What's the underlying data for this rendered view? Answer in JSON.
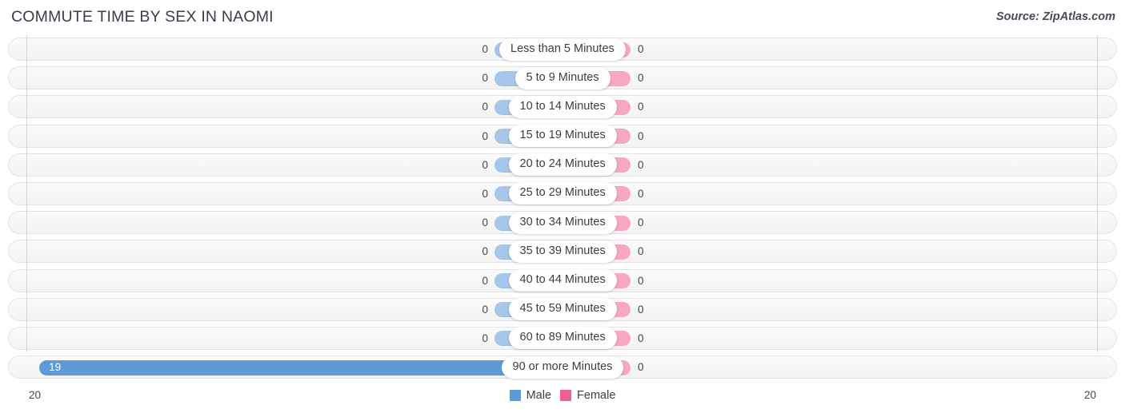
{
  "header": {
    "title": "COMMUTE TIME BY SEX IN NAOMI",
    "source": "Source: ZipAtlas.com"
  },
  "axis": {
    "left_max_label": "20",
    "right_max_label": "20",
    "max": 20
  },
  "legend": {
    "items": [
      {
        "label": "Male",
        "color": "#5c9bd6"
      },
      {
        "label": "Female",
        "color": "#ef5f92"
      }
    ]
  },
  "colors": {
    "male_active": "#5c9bd6",
    "male_zero": "#a6c6ea",
    "female_active": "#ef5f92",
    "female_zero": "#f7a7c2",
    "track": "#f7f7f7",
    "track_border": "#e3e3e5",
    "text": "#3c3c46"
  },
  "chart_data": {
    "type": "bar",
    "subtype": "butterfly",
    "title": "COMMUTE TIME BY SEX IN NAOMI",
    "xlabel": "",
    "ylabel": "",
    "xlim": [
      20,
      20
    ],
    "grid": true,
    "legend_position": "bottom-center",
    "categories": [
      "Less than 5 Minutes",
      "5 to 9 Minutes",
      "10 to 14 Minutes",
      "15 to 19 Minutes",
      "20 to 24 Minutes",
      "25 to 29 Minutes",
      "30 to 34 Minutes",
      "35 to 39 Minutes",
      "40 to 44 Minutes",
      "45 to 59 Minutes",
      "60 to 89 Minutes",
      "90 or more Minutes"
    ],
    "series": [
      {
        "name": "Male",
        "side": "left",
        "color": "#5c9bd6",
        "values": [
          0,
          0,
          0,
          0,
          0,
          0,
          0,
          0,
          0,
          0,
          0,
          19
        ],
        "labels": [
          "0",
          "0",
          "0",
          "0",
          "0",
          "0",
          "0",
          "0",
          "0",
          "0",
          "0",
          "19"
        ]
      },
      {
        "name": "Female",
        "side": "right",
        "color": "#ef5f92",
        "values": [
          0,
          0,
          0,
          0,
          0,
          0,
          0,
          0,
          0,
          0,
          0,
          0
        ],
        "labels": [
          "0",
          "0",
          "0",
          "0",
          "0",
          "0",
          "0",
          "0",
          "0",
          "0",
          "0",
          "0"
        ]
      }
    ]
  }
}
